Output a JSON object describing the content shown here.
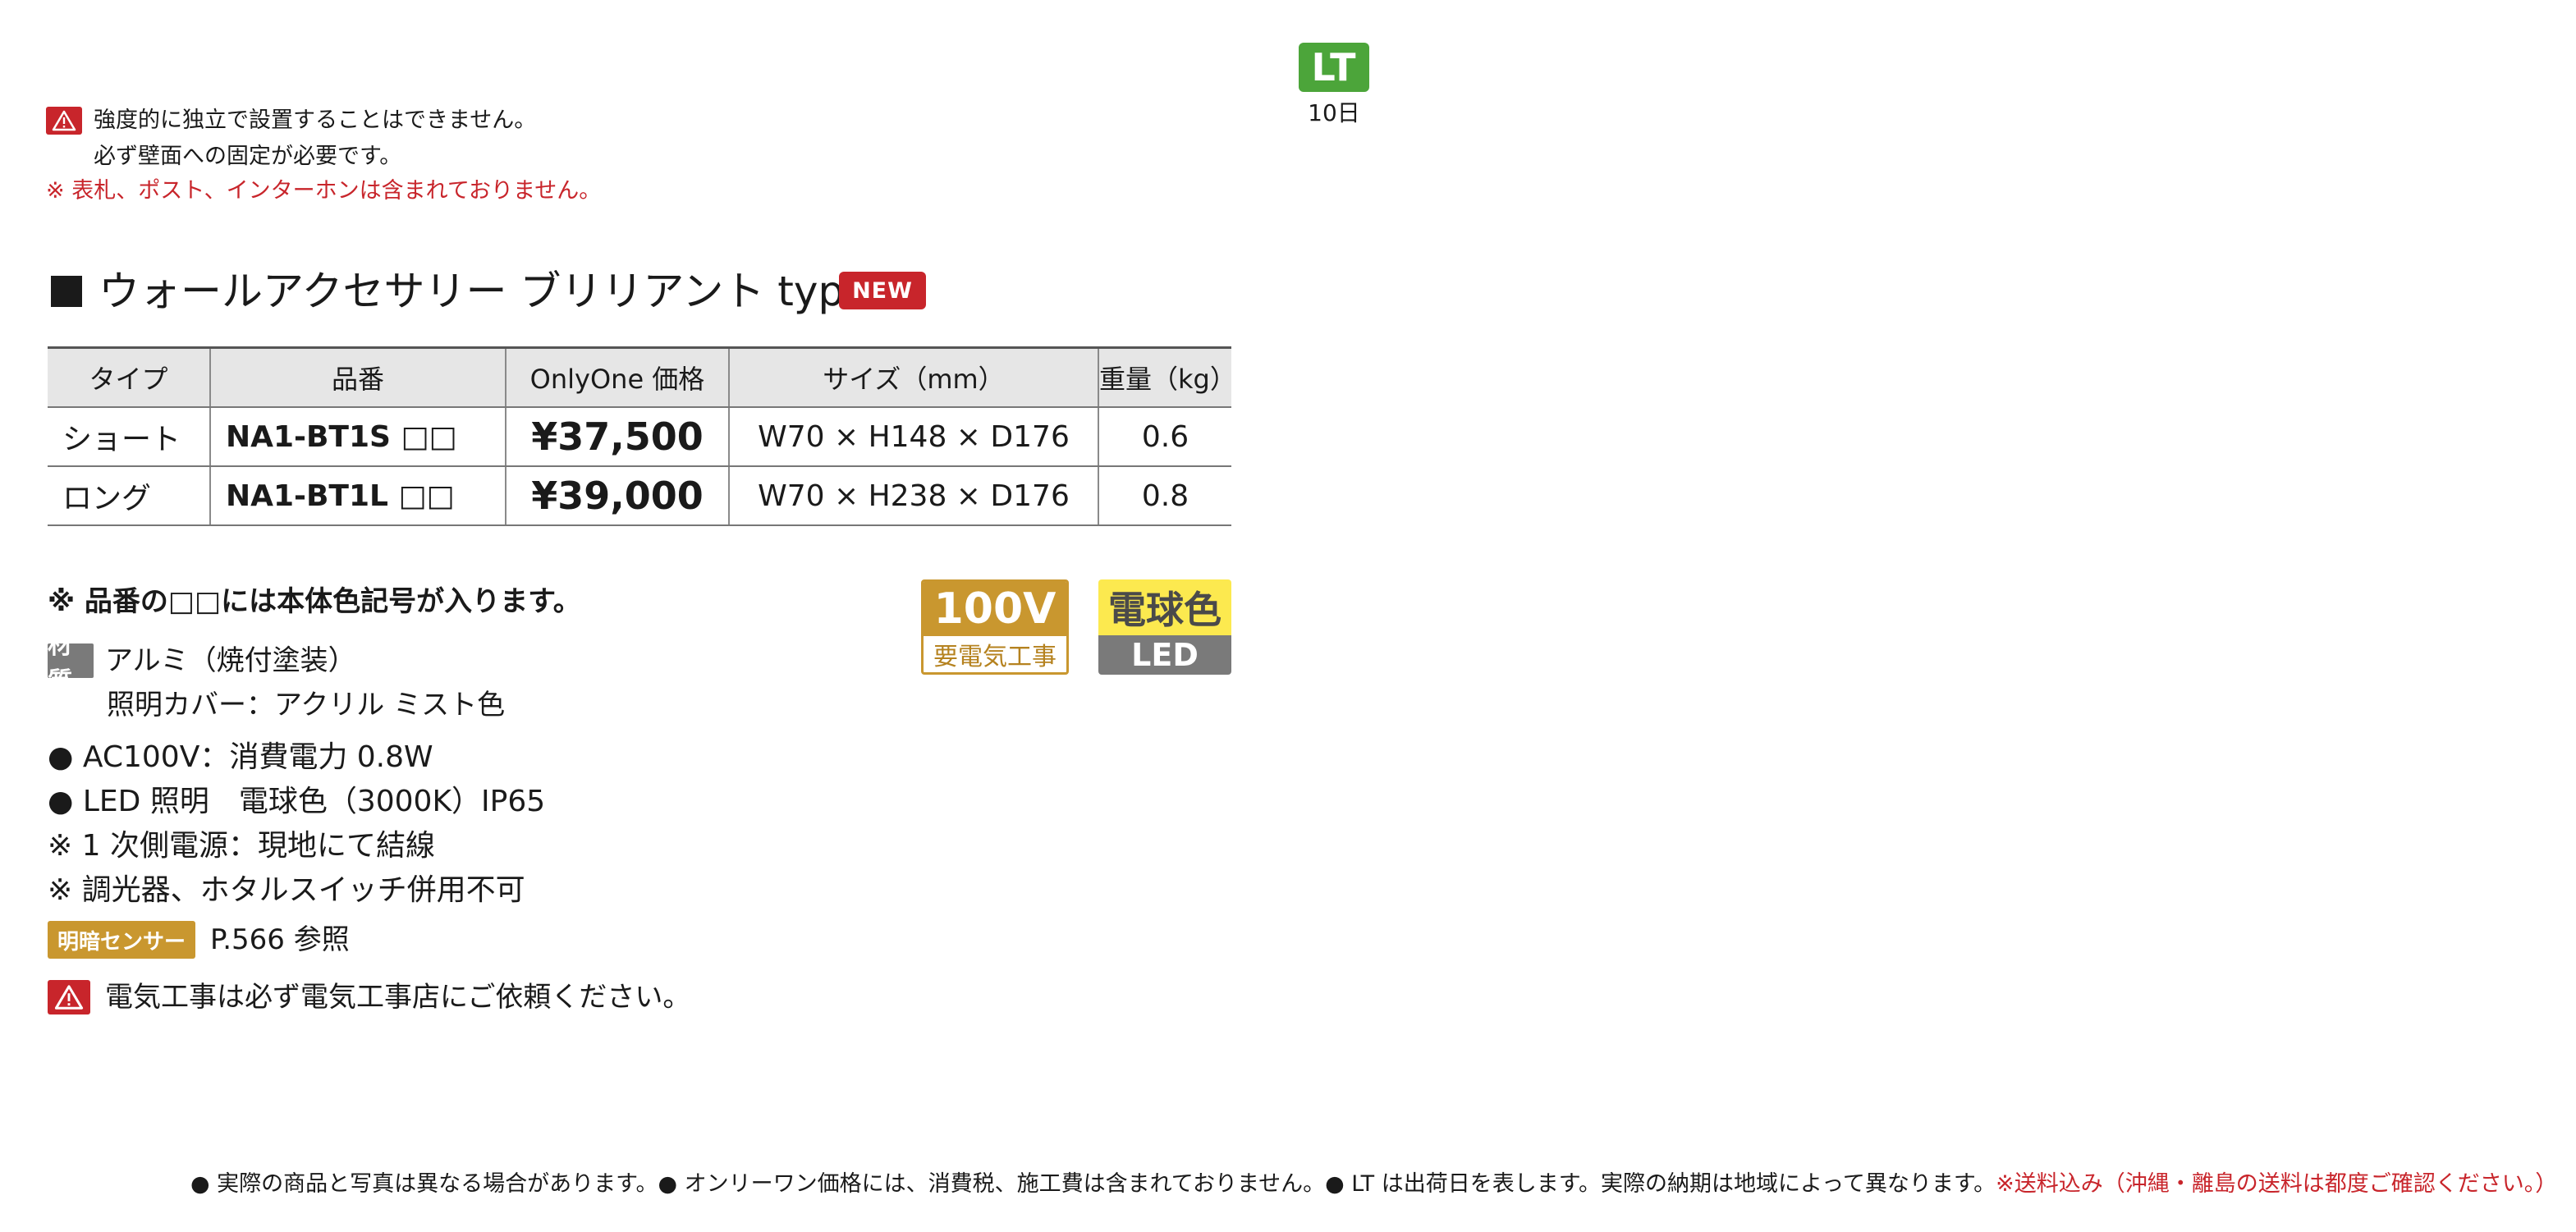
{
  "lead_time": {
    "badge": "LT",
    "days": "10日"
  },
  "top_warning": {
    "line1": "強度的に独立で設置することはできません。",
    "line2": "必ず壁面への固定が必要です。",
    "note": "※ 表札、ポスト、インターホンは含まれておりません。"
  },
  "heading": {
    "title": "ウォールアクセサリー ブリリアント type1",
    "new_badge": "NEW"
  },
  "table": {
    "headers": [
      "タイプ",
      "品番",
      "OnlyOne 価格",
      "サイズ（mm）",
      "重量（kg）"
    ],
    "rows": [
      [
        "ショート",
        "NA1-BT1S □□",
        "¥37,500",
        "W70 × H148 × D176",
        "0.6"
      ],
      [
        "ロング",
        "NA1-BT1L □□",
        "¥39,000",
        "W70 × H238 × D176",
        "0.8"
      ]
    ]
  },
  "notes": {
    "color_code": "※ 品番の□□には本体色記号が入ります。",
    "material_badge": "材質",
    "material": "アルミ（焼付塗装）",
    "cover": "照明カバー：アクリル ミスト色",
    "spec1": "● AC100V：消費電力 0.8W",
    "spec2": "● LED 照明　電球色（3000K）IP65",
    "spec3": "※ 1 次側電源：現地にて結線",
    "spec4": "※ 調光器、ホタルスイッチ併用不可",
    "sensor_badge": "明暗センサー",
    "sensor_ref": "P.566 参照",
    "electric_warning": "電気工事は必ず電気工事店にご依頼ください。"
  },
  "badges": {
    "voltage": "100V",
    "voltage_sub": "要電気工事",
    "light_color": "電球色",
    "light_type": "LED"
  },
  "footer": {
    "text": "● 実際の商品と写真は異なる場合があります。● オンリーワン価格には、消費税、施工費は含まれておりません。● LT は出荷日を表します。実際の納期は地域によって異なります。",
    "red_text": "※送料込み（沖縄・離島の送料は都度ご確認ください。）"
  },
  "colors": {
    "accent_red": "#c8252b",
    "lt_green": "#4ca53a",
    "gold": "#c9972f",
    "led_yellow": "#fce94f"
  }
}
